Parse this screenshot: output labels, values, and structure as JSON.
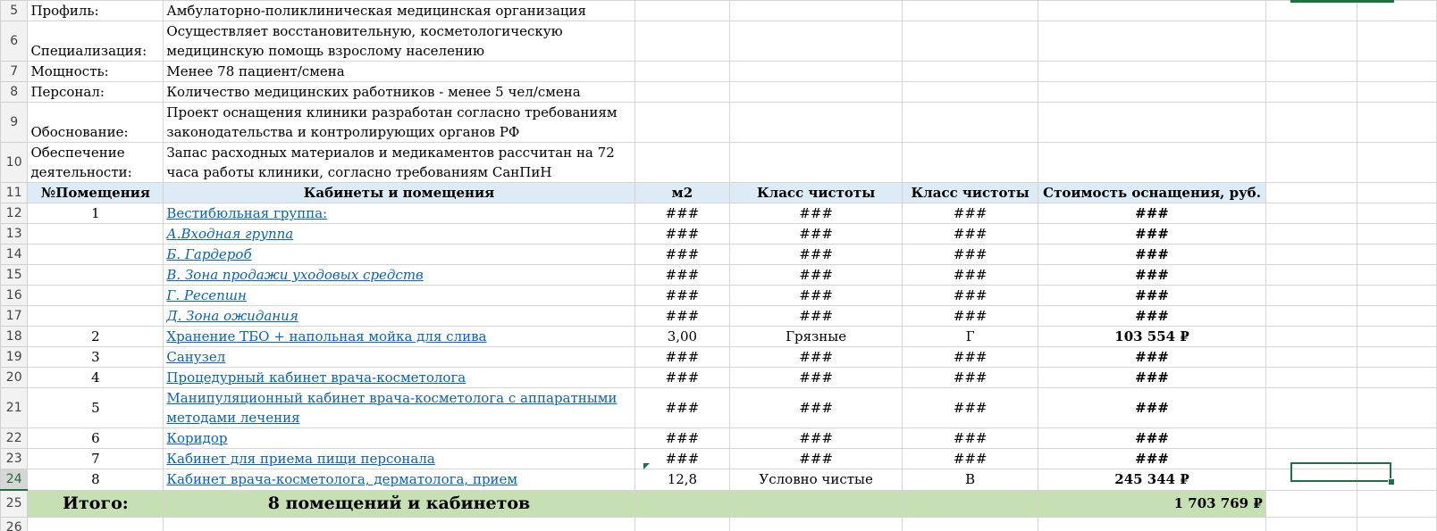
{
  "info_rows": [
    {
      "row": "5",
      "label": "Профиль:",
      "value": "Амбулаторно-поликлиническая медицинская организация"
    },
    {
      "row": "6",
      "label": "Специализация:",
      "value": "Осуществляет восстановительную, косметологическую медицинскую помощь взрослому населению"
    },
    {
      "row": "7",
      "label": "Мощность:",
      "value": "Менее 78 пациент/смена"
    },
    {
      "row": "8",
      "label": "Персонал:",
      "value": "Количество медицинских работников - менее 5 чел/смена"
    },
    {
      "row": "9",
      "label": "Обоснование:",
      "value": "Проект оснащения клиники разработан согласно требованиям законодательства  и контролирующих органов РФ"
    },
    {
      "row": "10",
      "label": "Обеспечение деятельности:",
      "value": "Запас расходных материалов и медикаментов рассчитан на 72 часа работы клиники, согласно требованиям СанПиН"
    }
  ],
  "header": {
    "row": "11",
    "col_num": "№Помещения",
    "col_name": "Кабинеты и помещения",
    "col_m2": "м2",
    "col_class1": "Класс чистоты",
    "col_class2": "Класс чистоты",
    "col_cost": "Стоимость оснащения, руб."
  },
  "rooms": [
    {
      "row": "12",
      "num": "1",
      "name": "Вестибюльная группа:",
      "italic": false,
      "m2": "###",
      "c1": "###",
      "c2": "###",
      "cost": "###"
    },
    {
      "row": "13",
      "num": "",
      "name": "А.Входная группа",
      "italic": true,
      "m2": "###",
      "c1": "###",
      "c2": "###",
      "cost": "###"
    },
    {
      "row": "14",
      "num": "",
      "name": "Б. Гардероб",
      "italic": true,
      "m2": "###",
      "c1": "###",
      "c2": "###",
      "cost": "###"
    },
    {
      "row": "15",
      "num": "",
      "name": "В. Зона продажи уходовых средств",
      "italic": true,
      "m2": "###",
      "c1": "###",
      "c2": "###",
      "cost": "###"
    },
    {
      "row": "16",
      "num": "",
      "name": "Г. Ресепшн",
      "italic": true,
      "m2": "###",
      "c1": "###",
      "c2": "###",
      "cost": "###"
    },
    {
      "row": "17",
      "num": "",
      "name": "Д. Зона ожидания",
      "italic": true,
      "m2": "###",
      "c1": "###",
      "c2": "###",
      "cost": "###"
    },
    {
      "row": "18",
      "num": "2",
      "name": "Хранение ТБО + напольная мойка для слива",
      "italic": false,
      "m2": "3,00",
      "c1": "Грязные",
      "c2": "Г",
      "cost": "103 554 ₽"
    },
    {
      "row": "19",
      "num": "3",
      "name": "Санузел",
      "italic": false,
      "m2": "###",
      "c1": "###",
      "c2": "###",
      "cost": "###"
    },
    {
      "row": "20",
      "num": "4",
      "name": "Процедурный кабинет врача-косметолога",
      "italic": false,
      "m2": "###",
      "c1": "###",
      "c2": "###",
      "cost": "###"
    },
    {
      "row": "21",
      "num": "5",
      "name": "Манипуляционный кабинет врача-косметолога с аппаратными методами лечения",
      "italic": false,
      "m2": "###",
      "c1": "###",
      "c2": "###",
      "cost": "###"
    },
    {
      "row": "22",
      "num": "6",
      "name": "Коридор",
      "italic": false,
      "m2": "###",
      "c1": "###",
      "c2": "###",
      "cost": "###"
    },
    {
      "row": "23",
      "num": "7",
      "name": "Кабинет для приема пищи персонала",
      "italic": false,
      "m2": "###",
      "c1": "###",
      "c2": "###",
      "cost": "###"
    },
    {
      "row": "24",
      "num": "8",
      "name": "Кабинет врача-косметолога, дерматолога, прием",
      "italic": false,
      "m2": "12,8",
      "c1": "Условно чистые",
      "c2": "В",
      "cost": "245 344 ₽"
    }
  ],
  "total": {
    "row": "25",
    "label": "Итого:",
    "summary": "8 помещений и кабинетов",
    "value": "1 703 769 ₽"
  },
  "tail_row": "26",
  "colors": {
    "header_bg": "#ddebf7",
    "total_bg": "#c6e0b4",
    "link": "#0563c1",
    "selection": "#1e7145"
  }
}
